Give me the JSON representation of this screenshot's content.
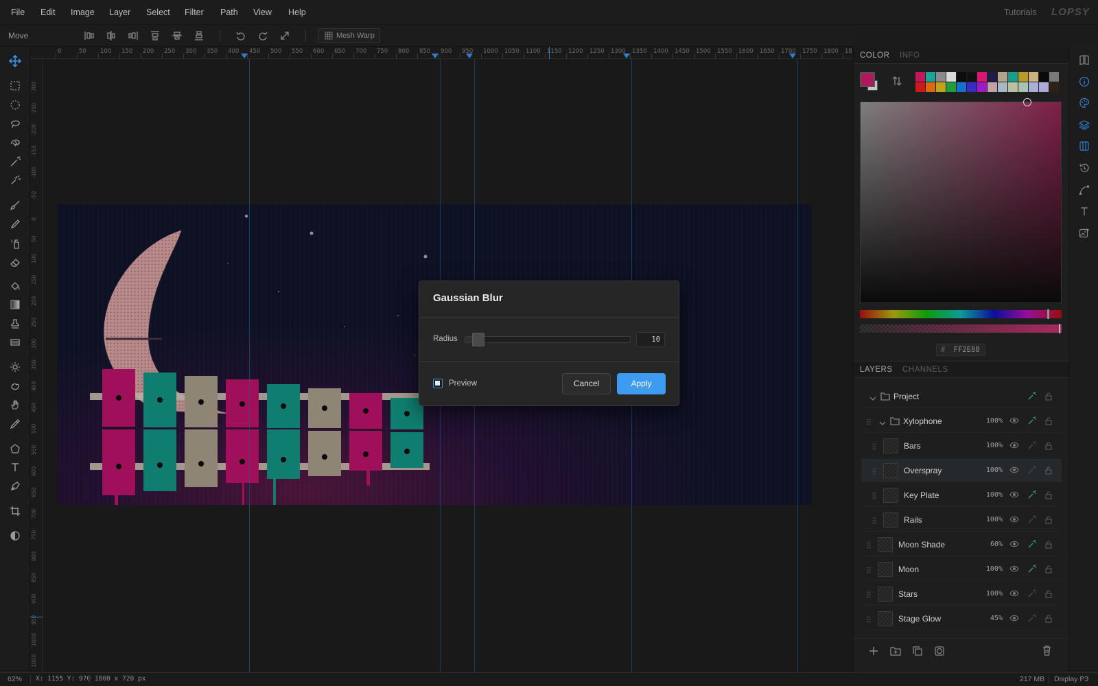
{
  "menu": {
    "items": [
      "File",
      "Edit",
      "Image",
      "Layer",
      "Select",
      "Filter",
      "Path",
      "View",
      "Help"
    ],
    "tutorials": "Tutorials",
    "brand": "LOPSY"
  },
  "options": {
    "tool_name": "Move",
    "mesh_warp": "Mesh Warp"
  },
  "ruler": {
    "top_ticks": [
      "0",
      "50",
      "100",
      "150",
      "200",
      "250",
      "300",
      "350",
      "400",
      "450",
      "500",
      "550",
      "600",
      "650",
      "700",
      "750",
      "800",
      "850",
      "900",
      "950",
      "1000",
      "1050",
      "1100",
      "1150",
      "1200",
      "1250",
      "1300",
      "1350",
      "1400",
      "1450",
      "1500",
      "1550",
      "1600",
      "1650",
      "1700",
      "1750",
      "1800",
      "18"
    ],
    "left_ticks": [
      "-300",
      "-250",
      "-200",
      "-150",
      "-100",
      "-50",
      "0",
      "50",
      "100",
      "150",
      "200",
      "250",
      "300",
      "350",
      "400",
      "450",
      "500",
      "550",
      "600",
      "650",
      "700",
      "750",
      "800",
      "850",
      "900",
      "950",
      "1000",
      "1050"
    ]
  },
  "toolbar": {
    "tools": [
      "move-tool-icon",
      "rect-marquee-icon",
      "ellipse-marquee-icon",
      "lasso-icon",
      "magnetic-lasso-icon",
      "magic-wand-icon",
      "quick-select-icon",
      "brush-icon",
      "pencil-icon",
      "spray-icon",
      "eraser-icon",
      "bucket-icon",
      "gradient-icon",
      "stamp-icon",
      "patch-icon",
      "dodge-icon",
      "smudge-icon",
      "hand-icon",
      "eyedropper-icon",
      "shape-icon",
      "text-icon",
      "pen-icon",
      "crop-icon",
      "contrast-icon"
    ]
  },
  "dialog": {
    "title": "Gaussian Blur",
    "radius_label": "Radius",
    "radius_value": "10",
    "radius_fraction": 0.04,
    "preview_label": "Preview",
    "preview_checked": false,
    "cancel": "Cancel",
    "apply": "Apply"
  },
  "color_panel": {
    "tabs": [
      "COLOR",
      "INFO"
    ],
    "hex_prefix": "#",
    "hex_value": "FF2E88",
    "foreground": "#b0185c",
    "swatches_row1": [
      "#c2185b",
      "#1aa39a",
      "#8a8a8a",
      "#d9d9d9",
      "#0d0d0d",
      "#111111",
      "#d4186d",
      "#1b1d4a",
      "#b5a58a",
      "#189e8a",
      "#b79a2a",
      "#c9b27c",
      "#0a0a0a",
      "#7a7a7a"
    ],
    "swatches_row2": [
      "#cc1a1a",
      "#d96a12",
      "#c4a21b",
      "#1f9e3a",
      "#1b6fcc",
      "#3a2ac4",
      "#9a1ac4",
      "#c4a0a8",
      "#a8b8c0",
      "#b8c0a0",
      "#a8c4b0",
      "#a8b0d8",
      "#b0a8d8",
      "#2c2218"
    ]
  },
  "layers_panel": {
    "tabs": [
      "LAYERS",
      "CHANNELS"
    ],
    "layers": [
      {
        "name": "Project",
        "opacity": "",
        "indent": 0,
        "group": true,
        "expanded": true
      },
      {
        "name": "Xylophone",
        "opacity": "100%",
        "indent": 1,
        "group": true,
        "expanded": true
      },
      {
        "name": "Bars",
        "opacity": "100%",
        "indent": 2
      },
      {
        "name": "Overspray",
        "opacity": "100%",
        "indent": 2,
        "selected": true
      },
      {
        "name": "Key Plate",
        "opacity": "100%",
        "indent": 2
      },
      {
        "name": "Rails",
        "opacity": "100%",
        "indent": 2
      },
      {
        "name": "Moon Shade",
        "opacity": "60%",
        "indent": 1
      },
      {
        "name": "Moon",
        "opacity": "100%",
        "indent": 1
      },
      {
        "name": "Stars",
        "opacity": "100%",
        "indent": 1
      },
      {
        "name": "Stage Glow",
        "opacity": "45%",
        "indent": 1
      }
    ]
  },
  "status": {
    "zoom": "62%",
    "coords": "X: 1155  Y: 970",
    "doc_size": "1800 x 720 px",
    "memory": "217 MB",
    "profile": "Display P3"
  }
}
